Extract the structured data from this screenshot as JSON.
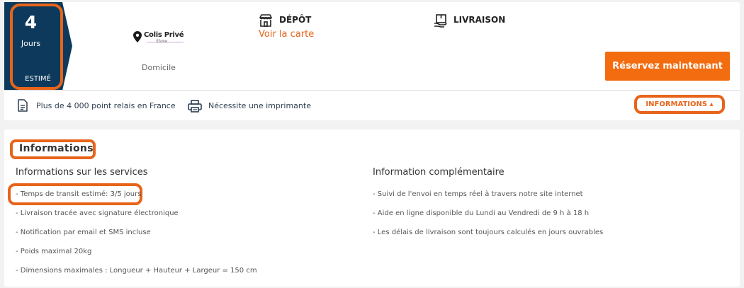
{
  "delivery_estimate": {
    "days": "4",
    "unit": "Jours",
    "qualifier": "ESTIMÉ"
  },
  "carrier": {
    "logo_name": "Colis Privé",
    "logo_sub": "Store",
    "service_type": "Domicile"
  },
  "depot": {
    "title": "DÉPÔT",
    "link": "Voir la carte",
    "icon": "store-icon"
  },
  "livraison": {
    "title": "LIVRAISON",
    "icon": "delivery-box-icon"
  },
  "actions": {
    "reserve_label": "Réservez maintenant",
    "info_toggle_label": "INFORMATIONS ▴"
  },
  "features": [
    {
      "icon": "document-icon",
      "label": "Plus de 4 000 point relais en France"
    },
    {
      "icon": "printer-icon",
      "label": "Nécessite une imprimante"
    }
  ],
  "info": {
    "heading": "Informations",
    "services": {
      "title": "Informations sur les services",
      "items": [
        "- Temps de transit estimé: 3/5 jours",
        "- Livraison tracée avec signature électronique",
        "- Notification par email et SMS incluse",
        "- Poids maximal 20kg",
        "- Dimensions maximales : Longueur + Hauteur + Largeur = 150 cm"
      ]
    },
    "complementary": {
      "title": "Information complémentaire",
      "items": [
        "- Suivi de l'envoi en temps réel à travers notre site internet",
        "- Aide en ligne disponible du Lundi au Vendredi de 9 h à 18 h",
        "- Les délais de livraison sont toujours calculés en jours ouvrables"
      ]
    }
  },
  "colors": {
    "accent": "#f36c0f",
    "highlight": "#e8641a",
    "badge": "#0d3a5c"
  }
}
